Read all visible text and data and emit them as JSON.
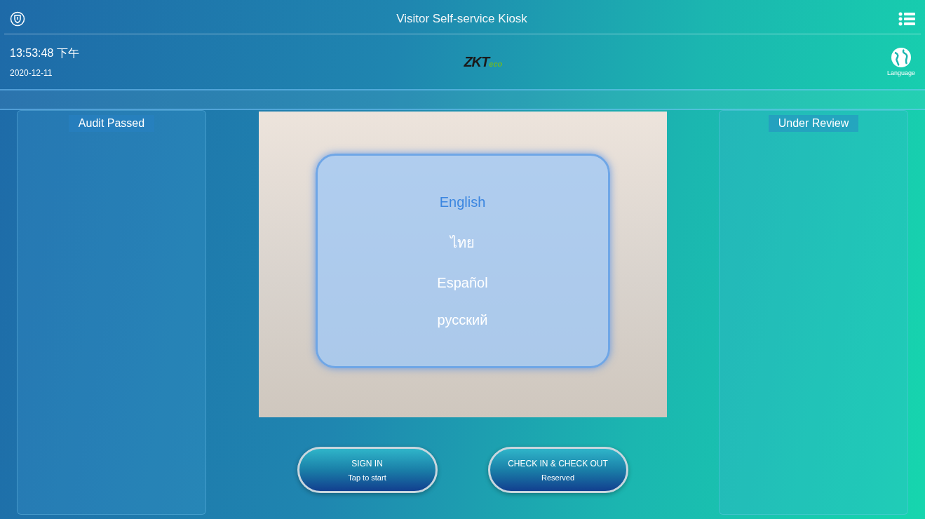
{
  "window": {
    "title": "Visitor Self-service Kiosk"
  },
  "clock": {
    "time": "13:53:48 下午",
    "date": "2020-12-11"
  },
  "logo": {
    "main": "ZKT",
    "sub": "eco"
  },
  "language_button": {
    "label": "Language"
  },
  "panels": [
    {
      "title": "Audit Passed"
    },
    {
      "title": "Under Review"
    }
  ],
  "language_menu": [
    {
      "label": "English",
      "selected": true
    },
    {
      "label": "ไทย",
      "selected": false
    },
    {
      "label": "Español",
      "selected": false
    },
    {
      "label": "русский",
      "selected": false
    }
  ],
  "actions": [
    {
      "title": "SIGN IN",
      "subtitle": "Tap to start"
    },
    {
      "title": "CHECK IN & CHECK OUT",
      "subtitle": "Reserved"
    }
  ]
}
